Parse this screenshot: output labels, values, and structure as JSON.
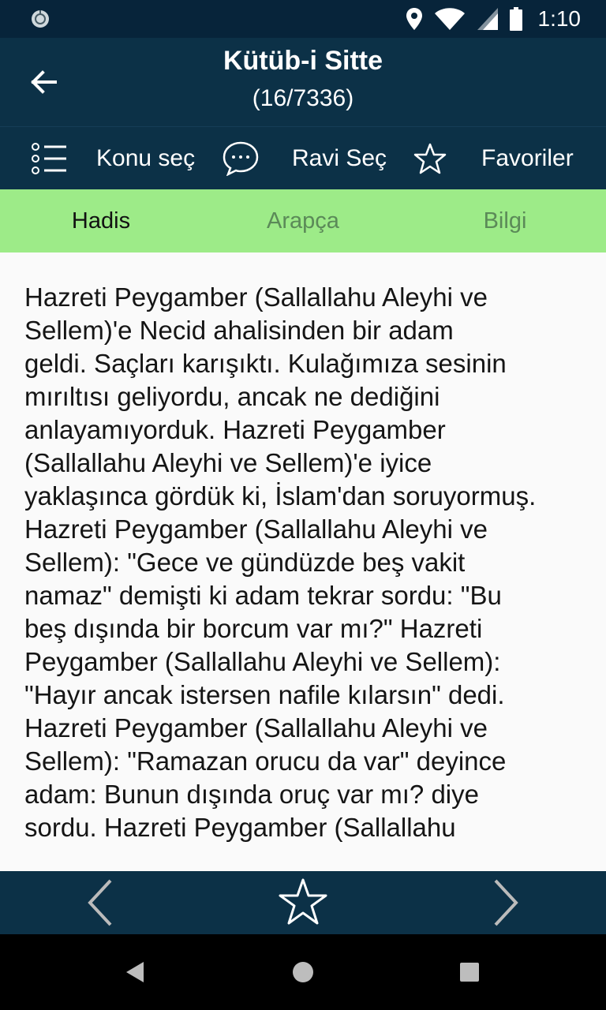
{
  "status_bar": {
    "time": "1:10",
    "icons": [
      "sync-icon",
      "location-icon",
      "wifi-icon",
      "signal-icon",
      "battery-icon"
    ]
  },
  "app_bar": {
    "title": "Kütüb-i Sitte",
    "subtitle": "(16/7336)"
  },
  "toolbar": {
    "topic_label": "Konu seç",
    "narrator_label": "Ravi Seç",
    "favorites_label": "Favoriler"
  },
  "tabs": [
    {
      "label": "Hadis",
      "active": true
    },
    {
      "label": "Arapça",
      "active": false
    },
    {
      "label": "Bilgi",
      "active": false
    }
  ],
  "content": {
    "lines": [
      "Hazreti Peygamber (Sallallahu Aleyhi ve",
      "Sellem)'e Necid ahalisinden bir adam",
      "geldi. Saçları karışıktı. Kulağımıza sesinin",
      "mırıltısı geliyordu, ancak ne dediğini",
      "anlayamıyorduk. Hazreti Peygamber",
      "(Sallallahu Aleyhi ve Sellem)'e iyice",
      "yaklaşınca gördük ki, İslam'dan soruyormuş.",
      "Hazreti Peygamber (Sallallahu Aleyhi ve",
      "Sellem): \"Gece ve gündüzde beş vakit",
      "namaz\" demişti ki adam tekrar sordu: \"Bu",
      "beş dışında bir borcum var mı?\" Hazreti",
      "Peygamber (Sallallahu Aleyhi ve Sellem):",
      "\"Hayır ancak istersen nafile kılarsın\" dedi.",
      "Hazreti Peygamber (Sallallahu Aleyhi ve",
      "Sellem): \"Ramazan orucu da var\" deyince",
      "adam: Bunun dışında oruç var mı? diye",
      "sordu. Hazreti Peygamber (Sallallahu"
    ]
  },
  "colors": {
    "status_bar": "#07243a",
    "app_bar": "#0c3147",
    "tab_bar": "#9deb88",
    "tab_inactive_text": "#5b8a58",
    "content_background": "#fafafa"
  }
}
